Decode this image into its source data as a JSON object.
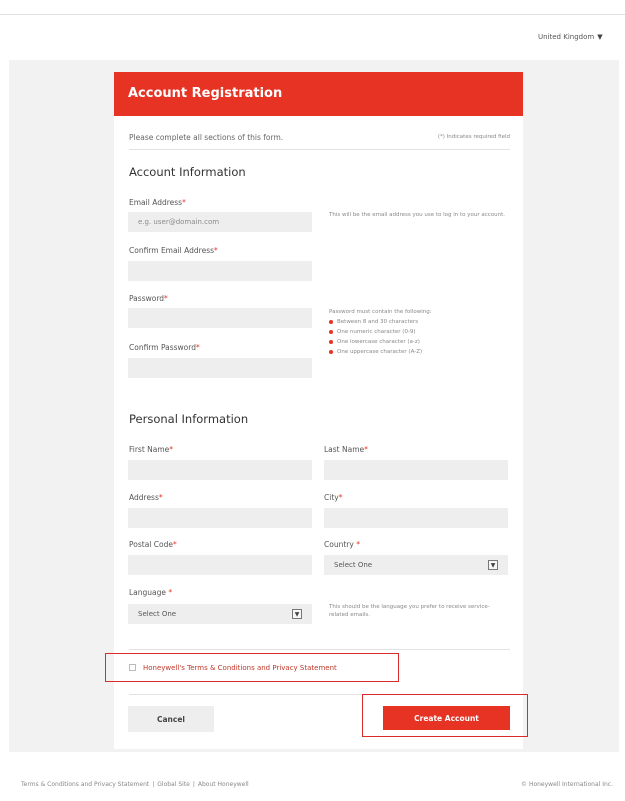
{
  "header": {
    "region": "United Kingdom"
  },
  "form": {
    "title": "Account Registration",
    "intro": "Please complete all sections of this form.",
    "required_note": "(*) Indicates required field",
    "account_section": {
      "title": "Account Information",
      "email_label": "Email Address",
      "email_placeholder": "e.g. user@domain.com",
      "email_help": "This will be the email address you use to log in to your account.",
      "confirm_email_label": "Confirm Email Address",
      "password_label": "Password",
      "confirm_password_label": "Confirm Password",
      "password_rules_title": "Password must contain the following:",
      "password_rules": [
        "Between 8 and 30 characters",
        "One numeric character (0-9)",
        "One lowercase character (a-z)",
        "One uppercase character (A-Z)"
      ]
    },
    "personal_section": {
      "title": "Personal Information",
      "first_name_label": "First Name",
      "last_name_label": "Last Name",
      "address_label": "Address",
      "city_label": "City",
      "postal_code_label": "Postal Code",
      "country_label": "Country",
      "country_value": "Select One",
      "language_label": "Language",
      "language_value": "Select One",
      "language_help": "This should be the language you prefer to receive service-related emails."
    },
    "required_mark": "*",
    "terms_label": "Honeywell's Terms & Conditions and Privacy Statement",
    "cancel_label": "Cancel",
    "create_label": "Create Account"
  },
  "footer": {
    "links": [
      "Terms & Conditions and Privacy Statement",
      "Global Site",
      "About Honeywell"
    ],
    "separator": "|",
    "copyright": "© Honeywell International Inc."
  },
  "colors": {
    "accent": "#e63324",
    "field_bg": "#eeeeee",
    "page_bg": "#f2f2f2"
  },
  "icons": {
    "region_chevron": "chevron-down-icon",
    "select_arrow": "dropdown-arrow-icon",
    "bullet": "red-bullet-icon"
  }
}
